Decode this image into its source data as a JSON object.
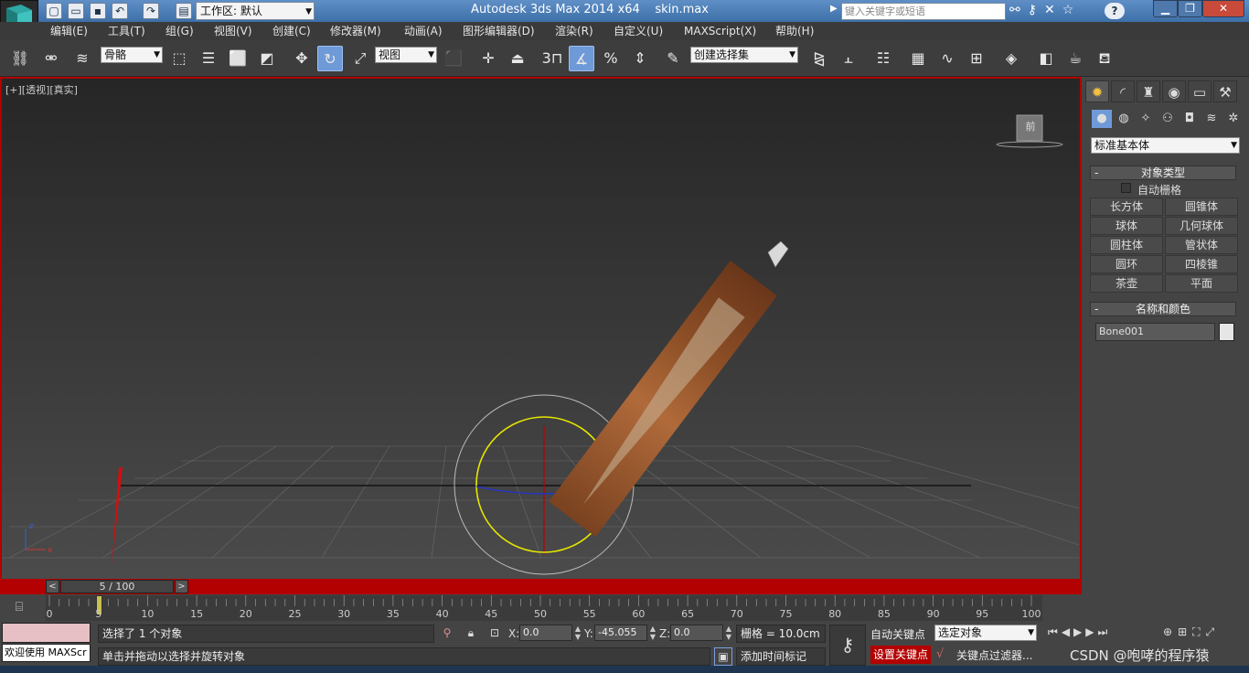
{
  "title_bar": {
    "app_title": "Autodesk 3ds Max  2014 x64",
    "file_name": "skin.max",
    "workspace_label": "工作区: 默认",
    "search_placeholder": "键入关键字或短语"
  },
  "menu": [
    "编辑(E)",
    "工具(T)",
    "组(G)",
    "视图(V)",
    "创建(C)",
    "修改器(M)",
    "动画(A)",
    "图形编辑器(D)",
    "渲染(R)",
    "自定义(U)",
    "MAXScript(X)",
    "帮助(H)"
  ],
  "toolbar": {
    "selection_filter": "骨骼",
    "reference_coord": "视图",
    "snap_value": "3",
    "named_selection": "创建选择集",
    "active_tool": "rotate"
  },
  "viewport": {
    "label": "[+][透视][真实]",
    "viewcube_face": "前"
  },
  "command_panel": {
    "category": "标准基本体",
    "object_type_title": "对象类型",
    "autogrid_label": "自动栅格",
    "object_buttons": [
      "长方体",
      "圆锥体",
      "球体",
      "几何球体",
      "圆柱体",
      "管状体",
      "圆环",
      "四棱锥",
      "茶壶",
      "平面"
    ],
    "name_color_title": "名称和颜色",
    "object_name": "Bone001",
    "object_color": "#e6e6e6"
  },
  "time_slider": {
    "frame_display": "5 / 100",
    "current_frame": 5,
    "total_frames": 100,
    "tick_labels": [
      "0",
      "5",
      "10",
      "15",
      "20",
      "25",
      "30",
      "35",
      "40",
      "45",
      "50",
      "55",
      "60",
      "65",
      "70",
      "75",
      "80",
      "85",
      "90",
      "95",
      "100"
    ]
  },
  "status": {
    "maxscript_label": "欢迎使用 MAXScr",
    "selection_status": "选择了 1 个对象",
    "prompt": "单击并拖动以选择并旋转对象",
    "x_value": "0.0",
    "y_value": "-45.055",
    "z_value": "0.0",
    "grid_label": "栅格 = 10.0cm",
    "add_time_tag": "添加时间标记",
    "auto_key": "自动关键点",
    "key_mode": "选定对象",
    "set_key": "设置关键点",
    "key_filters": "关键点过滤器..."
  },
  "watermark": "CSDN @咆哮的程序猿",
  "colors": {
    "viewport_border": "#b30000",
    "active_tool": "#6f9ad8",
    "title_bar": "#4a7cb6"
  }
}
